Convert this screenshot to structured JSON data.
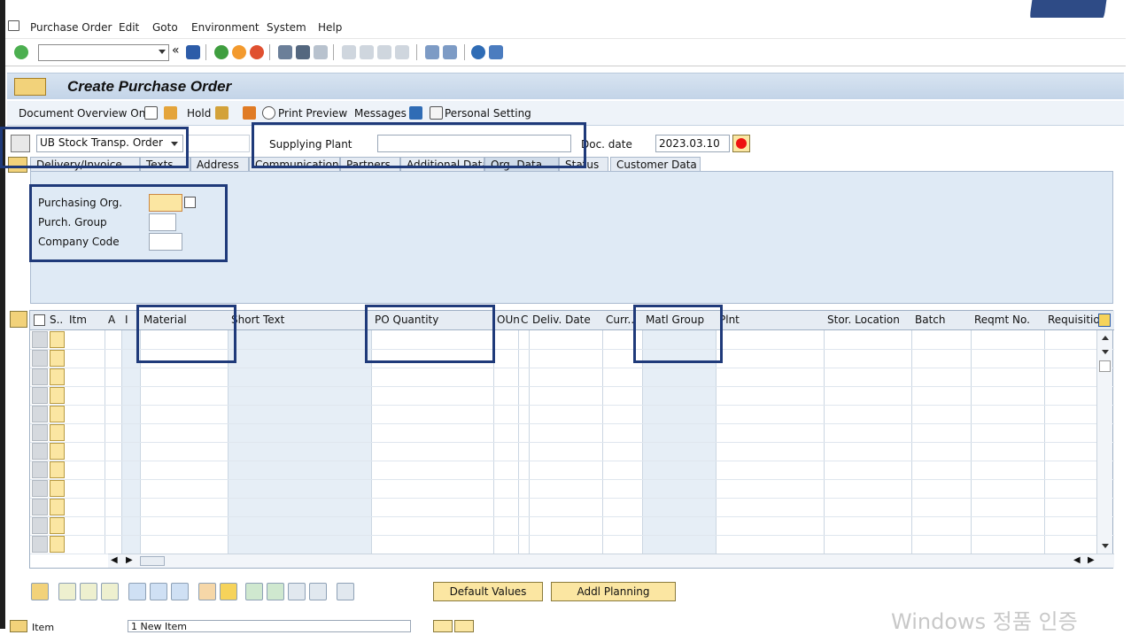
{
  "menu": {
    "items": [
      "Purchase Order",
      "Edit",
      "Goto",
      "Environment",
      "System",
      "Help"
    ]
  },
  "toolbar": {
    "command_value": ""
  },
  "title": "Create Purchase Order",
  "app_toolbar": {
    "doc_overview": "Document Overview On",
    "hold": "Hold",
    "print_preview": "Print Preview",
    "messages": "Messages",
    "personal_setting": "Personal Setting"
  },
  "header": {
    "order_type": "UB Stock Transp. Order",
    "supplying_plant_label": "Supplying Plant",
    "supplying_plant_value": "",
    "doc_date_label": "Doc. date",
    "doc_date_value": "2023.03.10"
  },
  "tabs": [
    "Delivery/Invoice",
    "Texts",
    "Address",
    "Communication",
    "Partners",
    "Additional Data",
    "Org. Data",
    "Status",
    "Customer Data"
  ],
  "org": {
    "purch_org_label": "Purchasing Org.",
    "purch_group_label": "Purch. Group",
    "company_code_label": "Company Code"
  },
  "grid": {
    "columns": [
      "S..",
      "Itm",
      "A",
      "I",
      "Material",
      "Short Text",
      "PO Quantity",
      "OUn",
      "C",
      "Deliv. Date",
      "Curr..",
      "Matl Group",
      "Plnt",
      "Stor. Location",
      "Batch",
      "Reqmt No.",
      "Requisitione"
    ],
    "rows": 12
  },
  "buttons": {
    "default_values": "Default Values",
    "addl_planning": "Addl Planning"
  },
  "item_select": {
    "label": "Item",
    "value": "1 New Item"
  },
  "watermark": "Windows 정품 인증"
}
